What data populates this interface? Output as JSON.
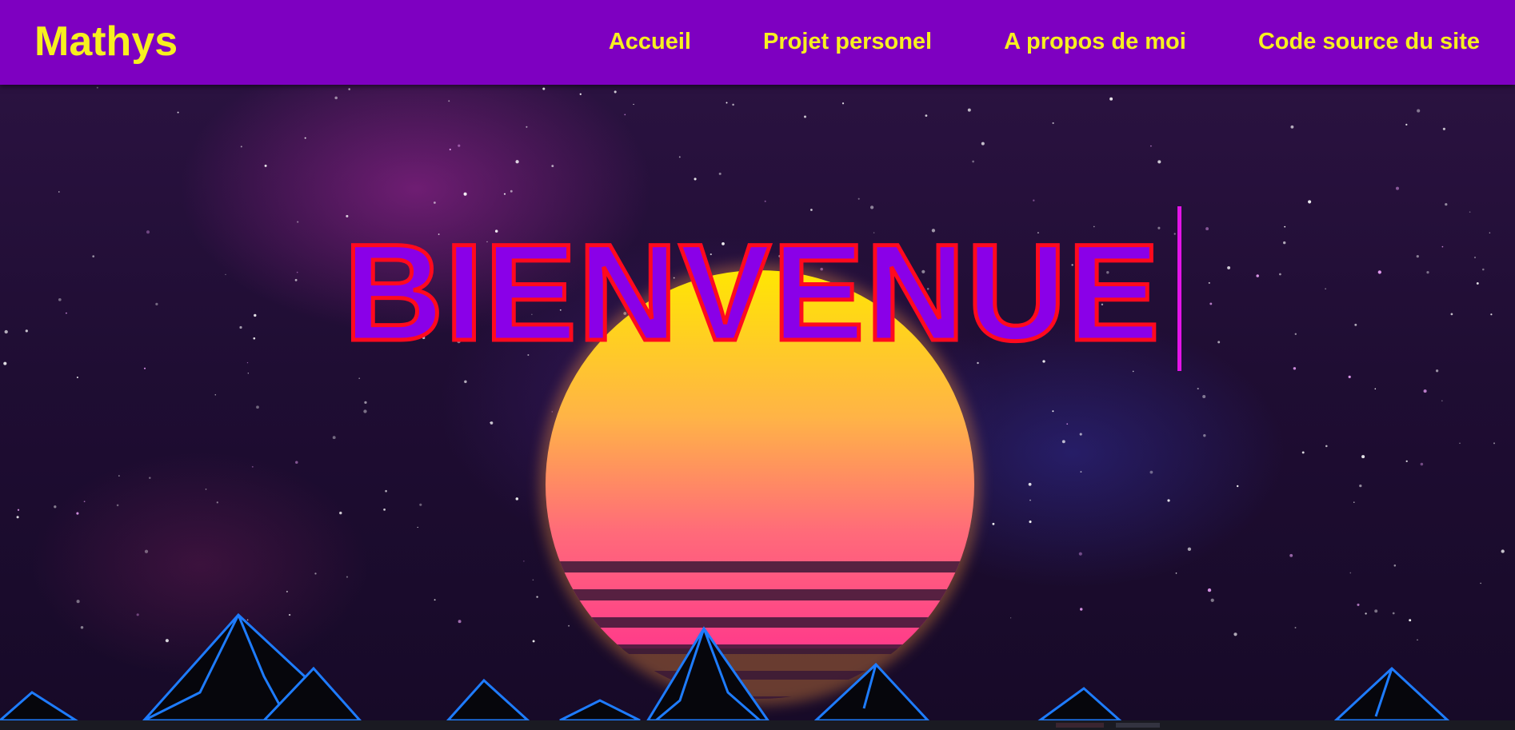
{
  "navbar": {
    "brand": "Mathys",
    "links": [
      {
        "label": "Accueil"
      },
      {
        "label": "Projet personel"
      },
      {
        "label": "A propos de moi"
      },
      {
        "label": "Code source du site"
      }
    ]
  },
  "hero": {
    "heading": "BIENVENUE"
  },
  "colors": {
    "navbar_bg": "#7e00c1",
    "nav_text": "#f7f01f",
    "heading_fill": "#8a00e8",
    "heading_stroke": "#ff0a1e",
    "caret": "#e314e8",
    "sun_top": "#ffe800",
    "sun_bottom": "#ff3b8a",
    "mountain_edge": "#1e7cff"
  },
  "icons": {
    "background": "retro-synthwave-sunset-illustration"
  }
}
